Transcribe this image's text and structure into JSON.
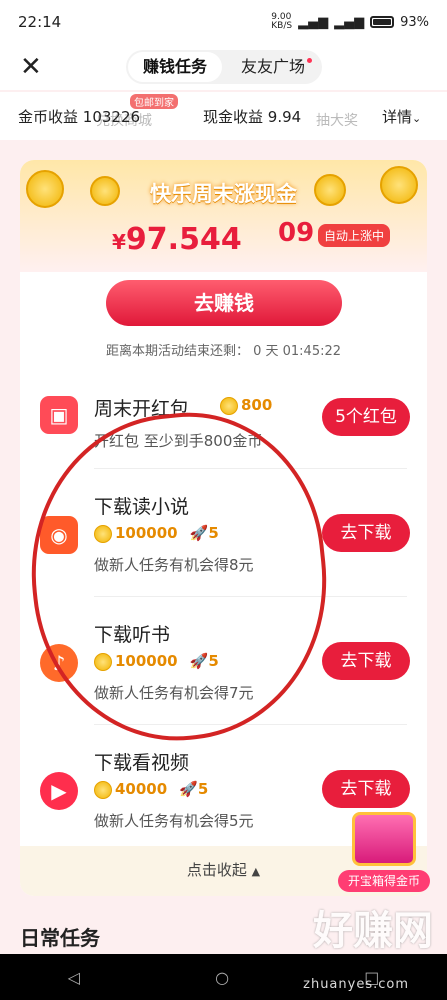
{
  "status": {
    "time": "22:14",
    "speed": "9.00\nKB/S",
    "battery": "93%"
  },
  "nav": {
    "tab_active": "赚钱任务",
    "tab_other": "友友广场"
  },
  "earnbar": {
    "coin_label": "金币收益",
    "coin_value": "103226",
    "cash_label": "现金收益",
    "cash_value": "9.94",
    "detail": "详情",
    "ghost_left": "兑换商城",
    "ghost_right": "抽大奖",
    "mail_tag": "包邮到家"
  },
  "banner": {
    "title": "快乐周末涨现金",
    "amount_prefix": "¥",
    "amount": "97.544",
    "amount_roll": "09",
    "auto_tag": "自动上涨中",
    "go_button": "去赚钱",
    "countdown": "距离本期活动结束还剩： 0 天 01:45:22"
  },
  "tasks": [
    {
      "name": "周末开红包",
      "coins": "800",
      "desc": "开红包 至少到手800金币",
      "button": "5个红包"
    },
    {
      "name": "下载读小说",
      "coins": "100000",
      "rocket": "5",
      "desc": "做新人任务有机会得8元",
      "button": "去下载"
    },
    {
      "name": "下载听书",
      "coins": "100000",
      "rocket": "5",
      "desc": "做新人任务有机会得7元",
      "button": "去下载"
    },
    {
      "name": "下载看视频",
      "coins": "40000",
      "rocket": "5",
      "desc": "做新人任务有机会得5元",
      "button": "去下载"
    }
  ],
  "collapse_label": "点击收起",
  "chest_label": "开宝箱得金币",
  "daily_title": "日常任务",
  "watermark": {
    "main": "好赚网",
    "sub": "zhuanyes.com"
  },
  "colors": {
    "accent": "#e81e3c",
    "gold": "#f1b300"
  }
}
